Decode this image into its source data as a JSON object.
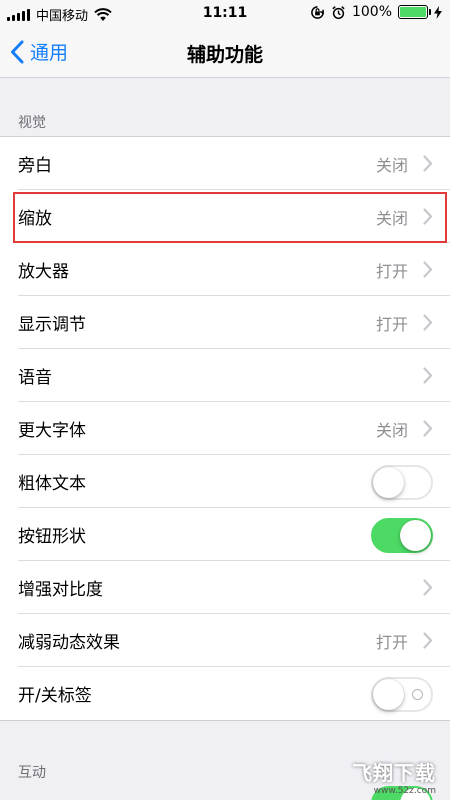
{
  "status_bar": {
    "carrier": "中国移动",
    "time": "11:11",
    "battery_percent_text": "100%",
    "battery_level": 1.0,
    "icons": [
      "signal-icon",
      "wifi-icon",
      "rotation-lock-icon",
      "alarm-icon",
      "battery-icon",
      "charging-icon"
    ]
  },
  "nav": {
    "back_label": "通用",
    "title": "辅助功能"
  },
  "sections": {
    "vision_header": "视觉",
    "interaction_header": "互动"
  },
  "rows": [
    {
      "label": "旁白",
      "value": "关闭",
      "accessory": "chevron"
    },
    {
      "label": "缩放",
      "value": "关闭",
      "accessory": "chevron"
    },
    {
      "label": "放大器",
      "value": "打开",
      "accessory": "chevron"
    },
    {
      "label": "显示调节",
      "value": "打开",
      "accessory": "chevron"
    },
    {
      "label": "语音",
      "value": "",
      "accessory": "chevron"
    },
    {
      "label": "更大字体",
      "value": "关闭",
      "accessory": "chevron"
    },
    {
      "label": "粗体文本",
      "toggle": false,
      "accessory": "toggle"
    },
    {
      "label": "按钮形状",
      "toggle": true,
      "accessory": "toggle"
    },
    {
      "label": "增强对比度",
      "value": "",
      "accessory": "chevron"
    },
    {
      "label": "减弱动态效果",
      "value": "打开",
      "accessory": "chevron"
    },
    {
      "label": "开/关标签",
      "toggle": false,
      "accessory": "toggle"
    }
  ],
  "watermark": {
    "text": "飞翔下载",
    "url": "www.52z.com"
  },
  "colors": {
    "accent": "#157efb",
    "toggle_on": "#4cd964",
    "highlight": "#e03a3a",
    "background": "#efeff4"
  }
}
